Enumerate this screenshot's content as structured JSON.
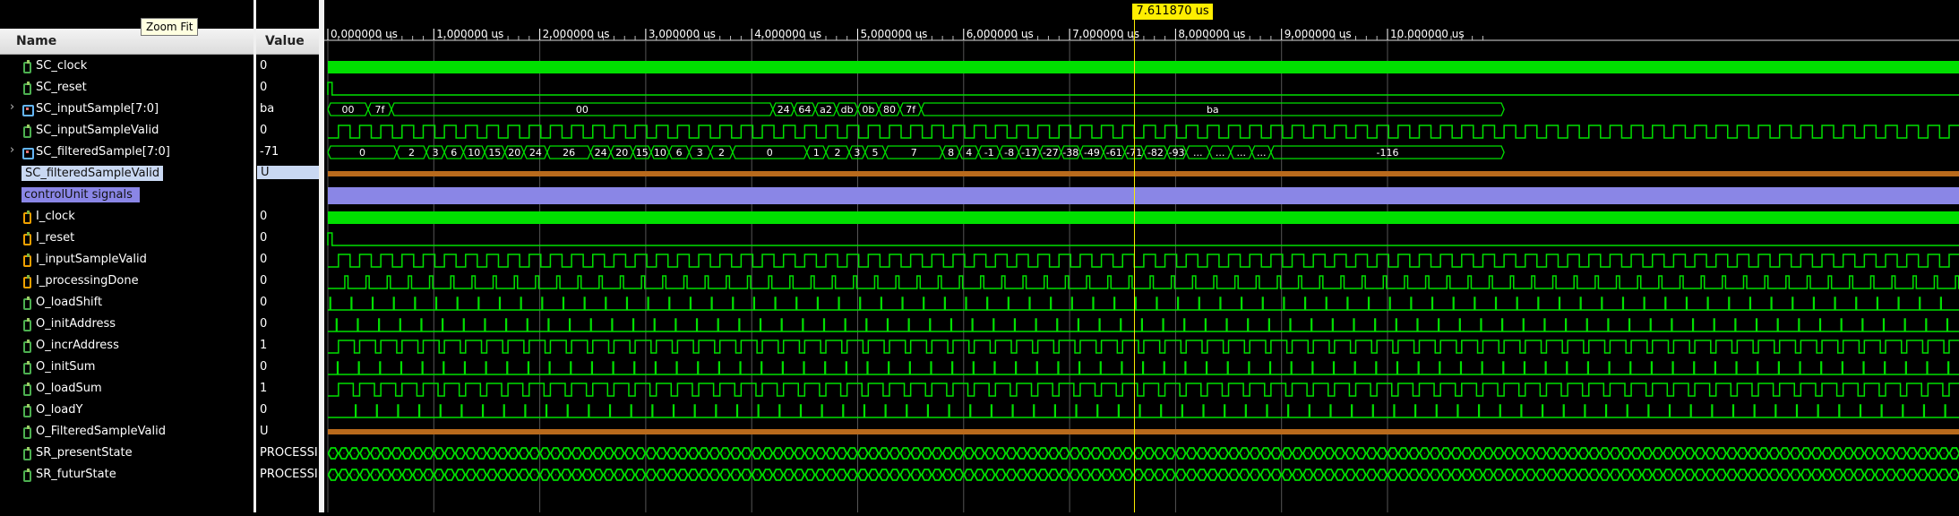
{
  "headers": {
    "name": "Name",
    "value": "Value"
  },
  "tooltip": "Zoom Fit",
  "cursor": {
    "time": 7.61187,
    "label": "7.611870 us"
  },
  "time_axis": {
    "unit": "us",
    "ticks": [
      "0.000000 us",
      "1.000000 us",
      "2.000000 us",
      "3.000000 us",
      "4.000000 us",
      "5.000000 us",
      "6.000000 us",
      "7.000000 us",
      "8.000000 us",
      "9.000000 us",
      "10.000000 us"
    ]
  },
  "signals": [
    {
      "name": "SC_clock",
      "value": "0",
      "icon": "bit-signal-icon",
      "kind": "bit"
    },
    {
      "name": "SC_reset",
      "value": "0",
      "icon": "bit-signal-icon",
      "kind": "bit"
    },
    {
      "name": "SC_inputSample[7:0]",
      "value": "ba",
      "icon": "bus-signal-icon",
      "kind": "bus",
      "expandable": true
    },
    {
      "name": "SC_inputSampleValid",
      "value": "0",
      "icon": "bit-signal-icon",
      "kind": "bit"
    },
    {
      "name": "SC_filteredSample[7:0]",
      "value": "-71",
      "icon": "bus-signal-icon",
      "kind": "bus",
      "expandable": true
    },
    {
      "name": "SC_filteredSampleValid",
      "value": "U",
      "icon": "bit-signal-icon",
      "kind": "bit",
      "selected": true
    },
    {
      "name": "controlUnit signals",
      "value": "",
      "icon": "",
      "kind": "group"
    },
    {
      "name": "I_clock",
      "value": "0",
      "icon": "input-port-icon",
      "kind": "inp"
    },
    {
      "name": "I_reset",
      "value": "0",
      "icon": "input-port-icon",
      "kind": "inp"
    },
    {
      "name": "I_inputSampleValid",
      "value": "0",
      "icon": "input-port-icon",
      "kind": "inp"
    },
    {
      "name": "I_processingDone",
      "value": "0",
      "icon": "input-port-icon",
      "kind": "inp"
    },
    {
      "name": "O_loadShift",
      "value": "0",
      "icon": "bit-signal-icon",
      "kind": "bit"
    },
    {
      "name": "O_initAddress",
      "value": "0",
      "icon": "bit-signal-icon",
      "kind": "bit"
    },
    {
      "name": "O_incrAddress",
      "value": "1",
      "icon": "bit-signal-icon",
      "kind": "bit"
    },
    {
      "name": "O_initSum",
      "value": "0",
      "icon": "bit-signal-icon",
      "kind": "bit"
    },
    {
      "name": "O_loadSum",
      "value": "1",
      "icon": "bit-signal-icon",
      "kind": "bit"
    },
    {
      "name": "O_loadY",
      "value": "0",
      "icon": "bit-signal-icon",
      "kind": "bit"
    },
    {
      "name": "O_FilteredSampleValid",
      "value": "U",
      "icon": "bit-signal-icon",
      "kind": "bit"
    },
    {
      "name": "SR_presentState",
      "value": "PROCESSING",
      "icon": "bit-signal-icon",
      "kind": "bit"
    },
    {
      "name": "SR_futurState",
      "value": "PROCESSING",
      "icon": "bit-signal-icon",
      "kind": "bit"
    }
  ],
  "waves": {
    "input_sample": [
      {
        "t0": 0.0,
        "t1": 0.38,
        "v": "00"
      },
      {
        "t0": 0.38,
        "t1": 0.6,
        "v": "7f"
      },
      {
        "t0": 0.6,
        "t1": 4.2,
        "v": "00"
      },
      {
        "t0": 4.2,
        "t1": 4.4,
        "v": "24"
      },
      {
        "t0": 4.4,
        "t1": 4.6,
        "v": "64"
      },
      {
        "t0": 4.6,
        "t1": 4.8,
        "v": "a2"
      },
      {
        "t0": 4.8,
        "t1": 5.0,
        "v": "db"
      },
      {
        "t0": 5.0,
        "t1": 5.2,
        "v": "0b"
      },
      {
        "t0": 5.2,
        "t1": 5.4,
        "v": "80"
      },
      {
        "t0": 5.4,
        "t1": 5.6,
        "v": "7f"
      },
      {
        "t0": 5.6,
        "t1": 11.1,
        "v": "ba"
      }
    ],
    "filtered_sample": [
      "0",
      "2",
      "3",
      "6",
      "10",
      "15",
      "20",
      "24",
      "26",
      "24",
      "20",
      "15",
      "10",
      "6",
      "3",
      "2",
      "0",
      "1",
      "2",
      "3",
      "5",
      "7",
      "8",
      "4",
      "-1",
      "-8",
      "-17",
      "-27",
      "-38",
      "-49",
      "-61",
      "-71",
      "-82",
      "-93",
      "...",
      "...",
      "...",
      "...",
      "-116"
    ]
  }
}
